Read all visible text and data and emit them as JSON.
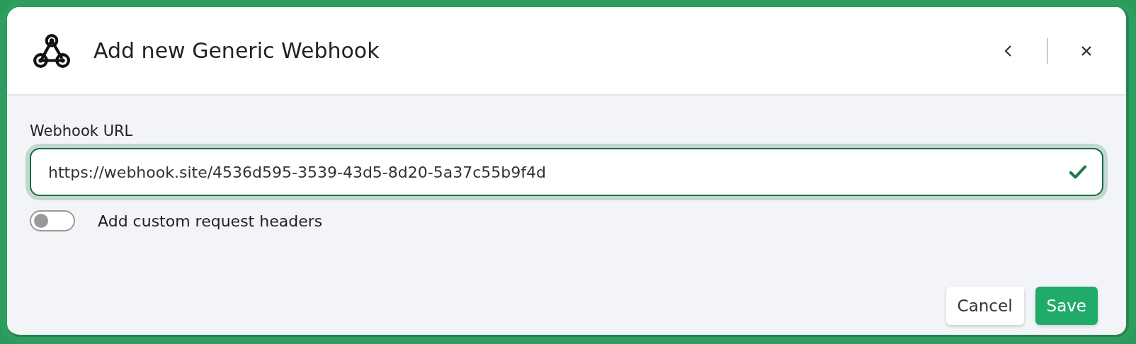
{
  "dialog": {
    "title": "Add new Generic Webhook"
  },
  "url_field": {
    "label": "Webhook URL",
    "value": "https://webhook.site/4536d595-3539-43d5-8d20-5a37c55b9f4d",
    "valid": true,
    "focused": true
  },
  "custom_headers": {
    "label": "Add custom request headers",
    "on": false
  },
  "buttons": [
    {
      "label": "Cancel",
      "kind": "secondary"
    },
    {
      "label": "Save",
      "kind": "primary"
    }
  ]
}
